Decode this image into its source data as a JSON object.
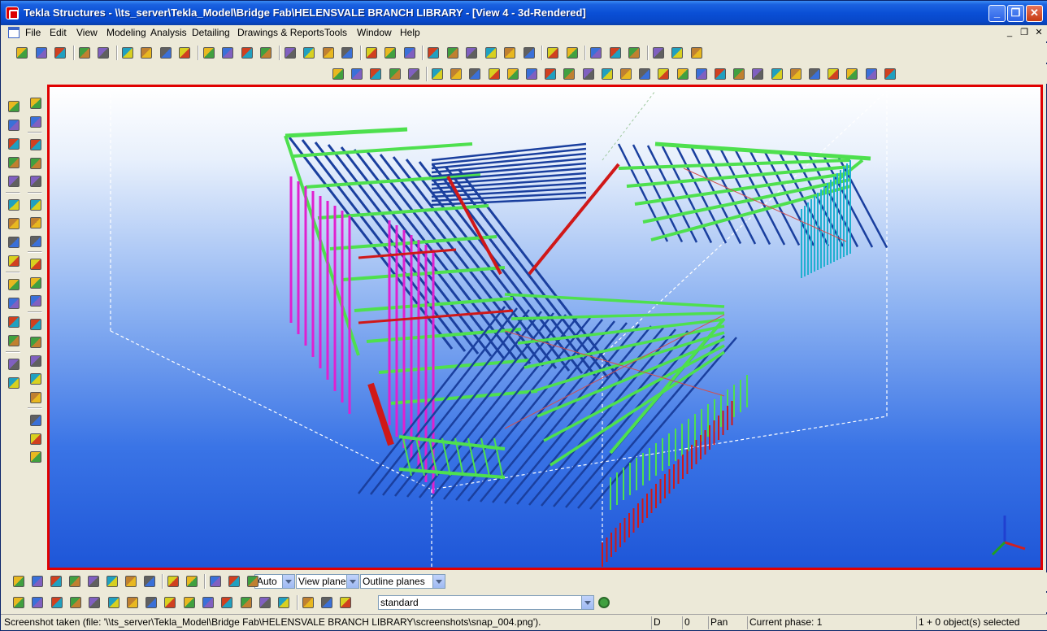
{
  "window": {
    "title": "Tekla Structures - \\\\ts_server\\Tekla_Model\\Bridge Fab\\HELENSVALE BRANCH LIBRARY - [View 4 - 3d-Rendered]",
    "minimize_glyph": "_",
    "maximize_glyph": "❐",
    "close_glyph": "✕"
  },
  "menu": {
    "items": [
      "File",
      "Edit",
      "View",
      "Modeling",
      "Analysis",
      "Detailing",
      "Drawings & Reports",
      "Tools",
      "Window",
      "Help"
    ],
    "mdi_minimize": "_",
    "mdi_restore": "❐",
    "mdi_close": "✕"
  },
  "selection_toolbar": {
    "combos": [
      {
        "name": "snap-depth-combo",
        "value": "Auto"
      },
      {
        "name": "view-plane-combo",
        "value": "View plane"
      },
      {
        "name": "outline-planes-combo",
        "value": "Outline planes"
      }
    ],
    "filter_value": "standard"
  },
  "status": {
    "message": "Screenshot taken (file: '\\\\ts_server\\Tekla_Model\\Bridge Fab\\HELENSVALE BRANCH LIBRARY\\screenshots\\snap_004.png').",
    "mode_d": "D",
    "counter": "0",
    "command": "Pan",
    "phase": "Current phase: 1",
    "selection": "1 + 0 object(s) selected"
  },
  "colors": {
    "viewport_border": "#e00000",
    "steel_green": "#4ee04e",
    "steel_blue": "#1a3f9e",
    "steel_magenta": "#e020d0",
    "steel_red": "#d01818",
    "steel_cyan": "#20b0d0"
  },
  "icons": {
    "top_toolbar": [
      "new-icon",
      "open-icon",
      "save-icon",
      "undo-icon",
      "redo-icon",
      "copy-icon",
      "paste-icon",
      "print-icon",
      "properties-icon",
      "view-icon",
      "window-icon",
      "cut-icon",
      "select-icon",
      "part-icon",
      "assembly-icon",
      "cast-unit-icon",
      "component-icon",
      "bolt-icon",
      "weld-icon",
      "inquire-icon",
      "grid-icon",
      "point-icon",
      "line-icon",
      "arc-icon",
      "dimension-icon",
      "pencil-icon",
      "copy-special-icon",
      "move-special-icon",
      "number-icon",
      "clash-icon",
      "forward-icon",
      "report-icon",
      "drawing-icon",
      "help-icon"
    ],
    "left_toolbar": [
      "column-icon",
      "beam-icon",
      "polybeam-icon",
      "curved-beam-icon",
      "plate-icon",
      "bolt-icon",
      "weld-icon",
      "binoculars-icon",
      "grid-icon",
      "component-icon",
      "material-icon",
      "red-part-icon",
      "yellow-part-icon",
      "connection-icon",
      "detail-icon"
    ]
  }
}
